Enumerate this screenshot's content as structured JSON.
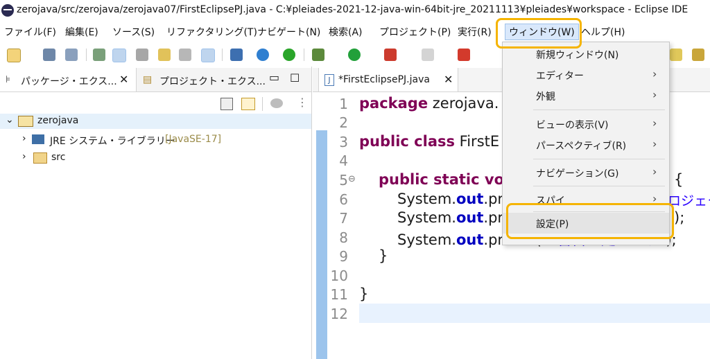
{
  "window": {
    "title": "zerojava/src/zerojava/zerojava07/FirstEclipsePJ.java - C:¥pleiades-2021-12-java-win-64bit-jre_20211113¥pleiades¥workspace - Eclipse IDE"
  },
  "menubar": {
    "items": [
      "ファイル(F)",
      "編集(E)",
      "ソース(S)",
      "リファクタリング(T)",
      "ナビゲート(N)",
      "検索(A)",
      "プロジェクト(P)",
      "実行(R)",
      "ウィンドウ(W)",
      "ヘルプ(H)"
    ]
  },
  "left": {
    "tab1": "パッケージ・エクス...",
    "tab2": "プロジェクト・エクス...",
    "tree": {
      "project": "zerojava",
      "jre": "JRE システム・ライブラリー",
      "jre_tag": "[JavaSE-17]",
      "src": "src"
    }
  },
  "editor": {
    "tab": "*FirstEclipsePJ.java",
    "line_numbers": [
      "1",
      "2",
      "3",
      "4",
      "5",
      "6",
      "7",
      "8",
      "9",
      "10",
      "11",
      "12"
    ],
    "code": {
      "l1_kw": "package",
      "l1_rest": " zerojava.",
      "l3_kw": "public class",
      "l3_rest": " FirstE",
      "l5_kw": "public static vo",
      "l6_a": "System.",
      "l6_b": "out",
      "l6_c": ".pr",
      "l7_a": "System.",
      "l7_b": "out",
      "l7_c": ".pr",
      "l8_a": "System.",
      "l8_b": "out",
      "l8_c": ".println(",
      "l8_d": "\"3番目の処理です\"",
      "l8_e": ");",
      "l9": "}",
      "l11": "}",
      "r5": "{",
      "r6": "ロジェク",
      "r7": ");",
      "fold_marker": "⊖"
    }
  },
  "dropdown": {
    "items": [
      {
        "label": "新規ウィンドウ(N)",
        "submenu": false
      },
      {
        "label": "エディター",
        "submenu": true
      },
      {
        "label": "外観",
        "submenu": true
      },
      {
        "label": "ビューの表示(V)",
        "submenu": true
      },
      {
        "label": "パースペクティブ(R)",
        "submenu": true
      },
      {
        "label": "ナビゲーション(G)",
        "submenu": true
      },
      {
        "label": "スパイ",
        "submenu": true
      },
      {
        "label": "設定(P)",
        "submenu": false
      }
    ],
    "arrow": "›"
  },
  "colors": {
    "highlight": "#f5b400",
    "keyword": "#7f0055",
    "field": "#0000c0",
    "string": "#2a00ff"
  }
}
